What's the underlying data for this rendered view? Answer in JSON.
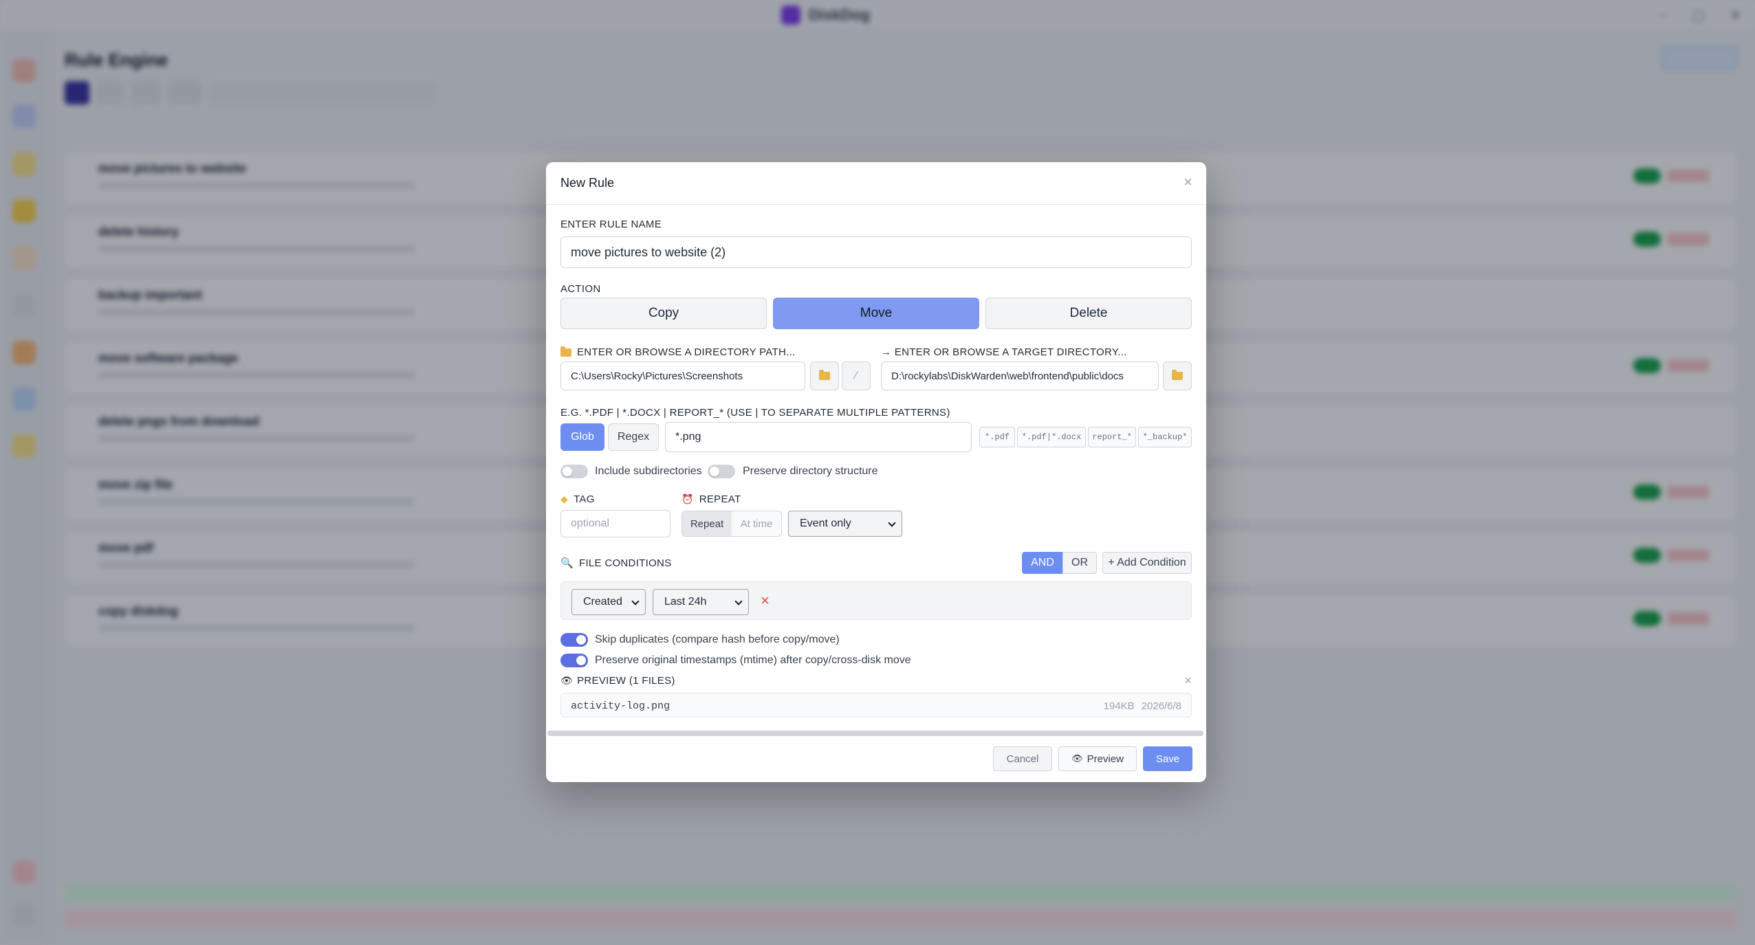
{
  "app": {
    "window_title": "DiskDog",
    "page_title": "Rule Engine",
    "rules": [
      "move pictures to website",
      "delete history",
      "backup important",
      "move software package",
      "delete pngs from download",
      "move zip file",
      "move pdf",
      "copy diskdog"
    ]
  },
  "modal": {
    "title": "New Rule",
    "close_glyph": "×",
    "rule_name": {
      "label": "ENTER RULE NAME",
      "value": "move pictures to website (2)"
    },
    "action": {
      "label": "ACTION",
      "options": [
        "Copy",
        "Move",
        "Delete"
      ],
      "selected": "Move"
    },
    "source": {
      "label": "ENTER OR BROWSE A DIRECTORY PATH...",
      "value": "C:\\Users\\Rocky\\Pictures\\Screenshots"
    },
    "target": {
      "label": "→ ENTER OR BROWSE A TARGET DIRECTORY...",
      "value": "D:\\rockylabs\\DiskWarden\\web\\frontend\\public\\docs"
    },
    "pattern": {
      "label": "E.G. *.PDF | *.DOCX | REPORT_* (USE | TO SEPARATE MULTIPLE PATTERNS)",
      "modes": [
        "Glob",
        "Regex"
      ],
      "selected_mode": "Glob",
      "value": "*.png",
      "chips": [
        "*.pdf",
        "*.pdf|*.docx",
        "report_*",
        "*_backup*"
      ]
    },
    "options": {
      "include_subdirectories": "Include subdirectories",
      "preserve_structure": "Preserve directory structure"
    },
    "tag": {
      "label": "TAG",
      "placeholder": "optional"
    },
    "repeat": {
      "label": "REPEAT",
      "modes": [
        "Repeat",
        "At time"
      ],
      "selected_mode": "Repeat",
      "schedule": "Event only"
    },
    "conditions": {
      "label": "FILE CONDITIONS",
      "logic": [
        "AND",
        "OR"
      ],
      "selected_logic": "AND",
      "add_label": "+ Add Condition",
      "items": [
        {
          "field": "Created",
          "value": "Last 24h",
          "remove": "×"
        }
      ]
    },
    "flags": {
      "skip_duplicates": "Skip duplicates (compare hash before copy/move)",
      "preserve_timestamps": "Preserve original timestamps (mtime) after copy/cross-disk move"
    },
    "preview": {
      "label": "PREVIEW (1 FILES)",
      "files": [
        {
          "name": "activity-log.png",
          "size": "194KB",
          "date": "2026/6/8"
        }
      ]
    },
    "footer": {
      "cancel": "Cancel",
      "preview": "Preview",
      "save": "Save"
    }
  },
  "colors": {
    "accent": "#6d8ef0",
    "toggle_on": "#5b6fe3",
    "danger": "#ef4444",
    "folder": "#e8b54a"
  }
}
